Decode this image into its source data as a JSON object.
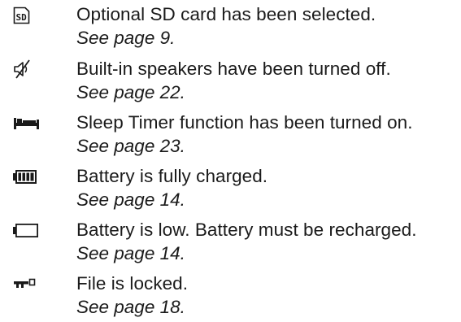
{
  "items": [
    {
      "icon": "sd-card-icon",
      "description": "Optional SD card has been selected.",
      "reference": "See page 9.",
      "icon_text": "SD"
    },
    {
      "icon": "speaker-off-icon",
      "description": "Built-in speakers have been turned off.",
      "reference": "See page 22."
    },
    {
      "icon": "sleep-timer-icon",
      "description": "Sleep Timer function has been turned on.",
      "reference": "See page 23."
    },
    {
      "icon": "battery-full-icon",
      "description": "Battery is fully charged.",
      "reference": "See page 14."
    },
    {
      "icon": "battery-low-icon",
      "description": "Battery is low. Battery must be recharged.",
      "reference": "See page 14."
    },
    {
      "icon": "file-lock-icon",
      "description": "File is locked.",
      "reference": "See page 18."
    }
  ],
  "colors": {
    "text": "#1a1a1a",
    "icon": "#1a1a1a",
    "background": "#ffffff"
  }
}
